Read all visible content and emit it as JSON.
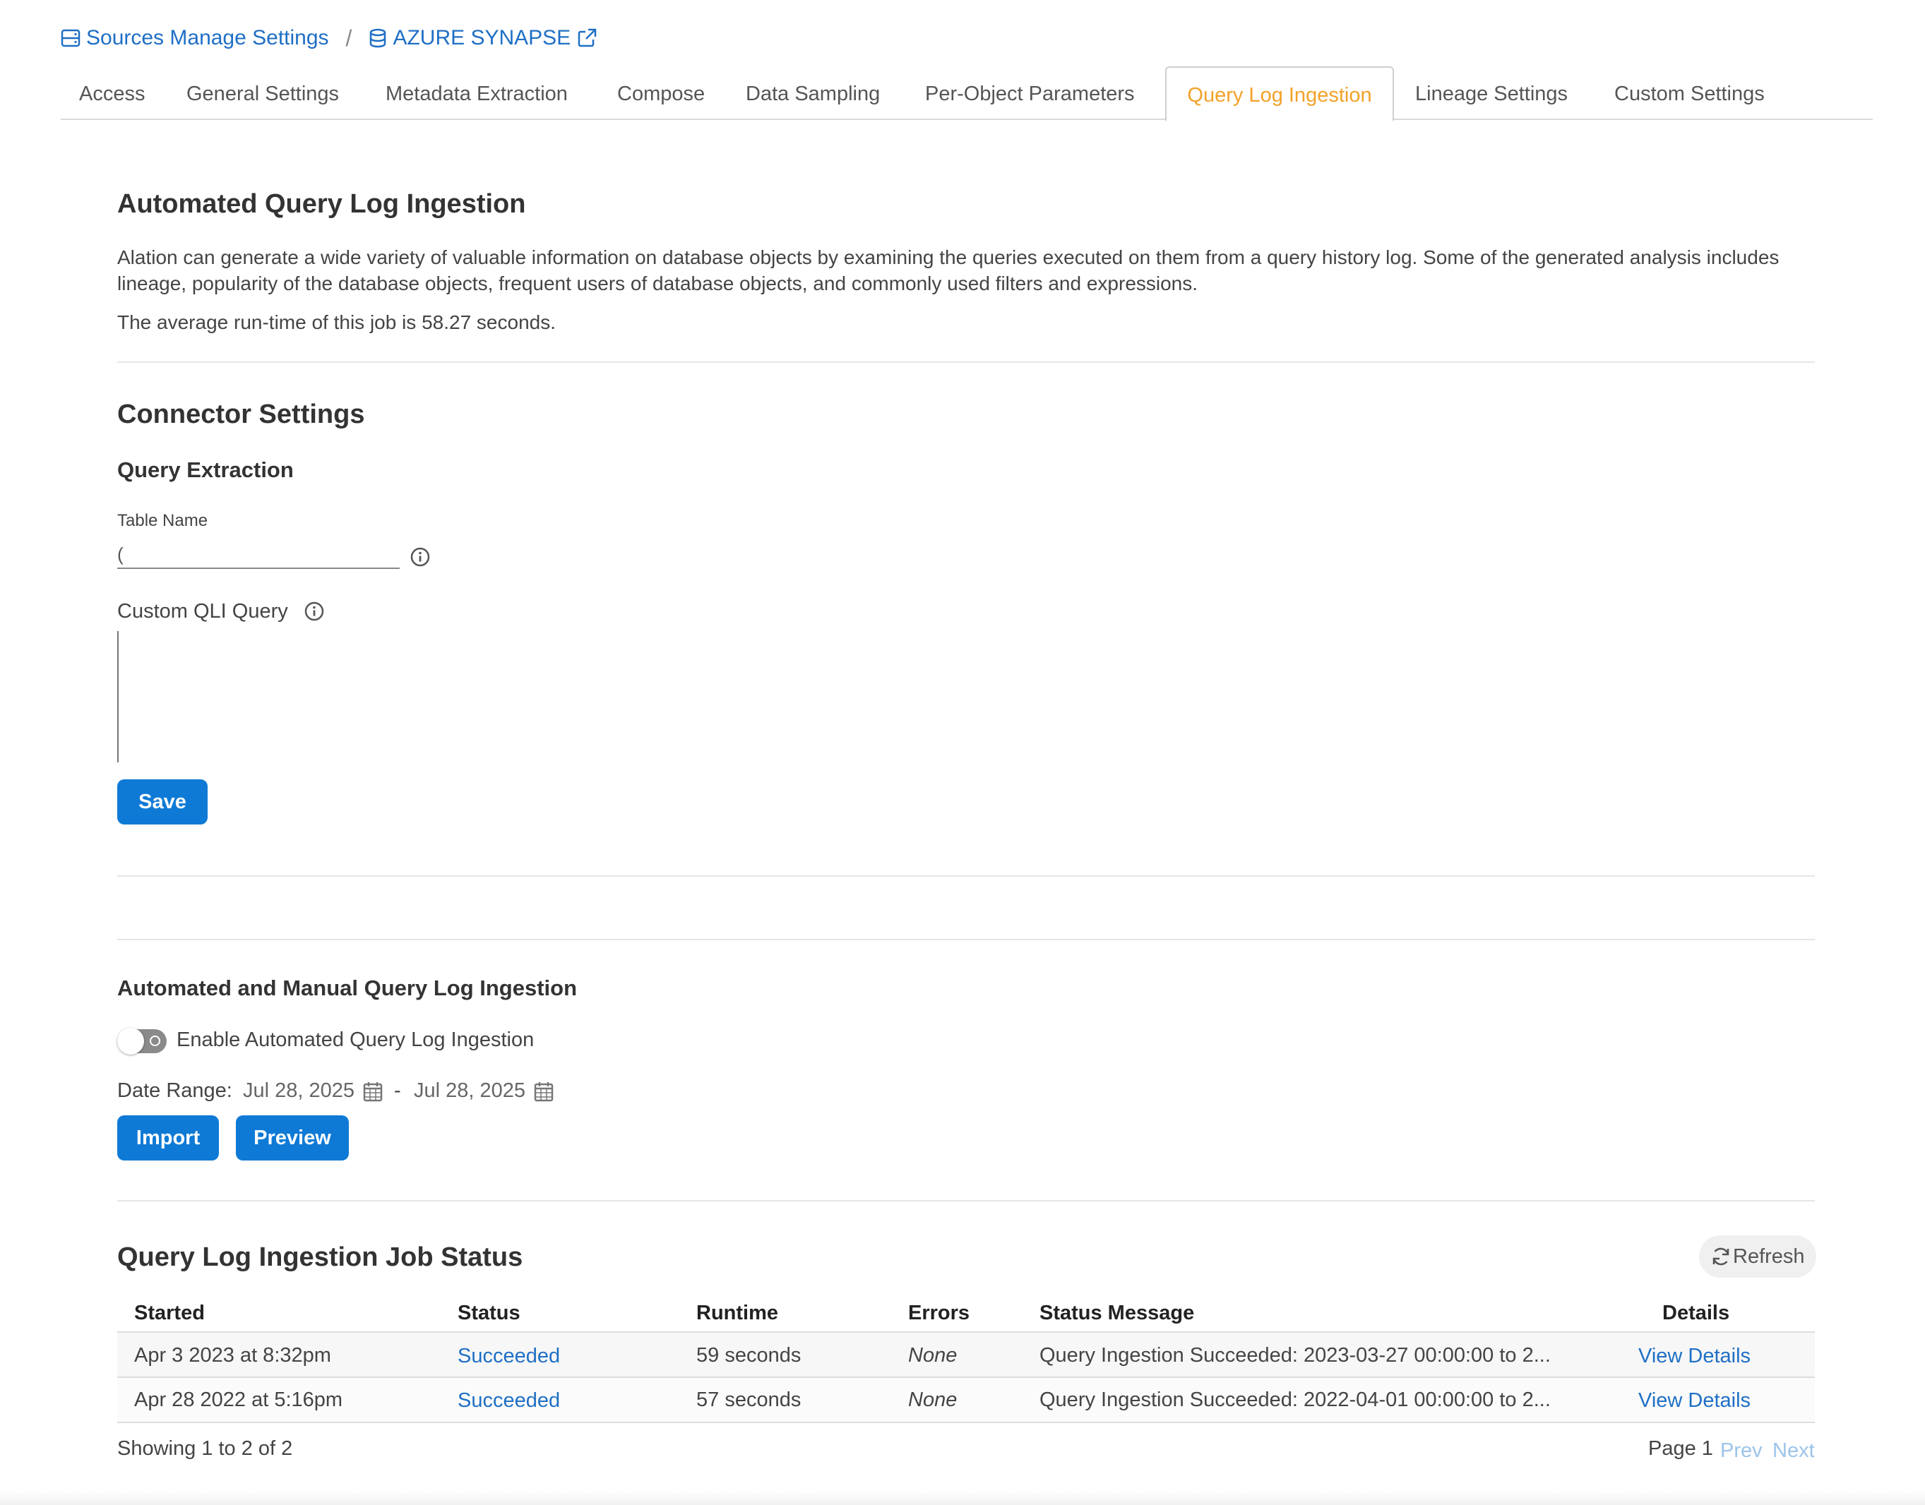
{
  "breadcrumb": {
    "source_label": "Sources Manage Settings",
    "separator": "/",
    "db_label": "AZURE SYNAPSE"
  },
  "tabs": [
    {
      "label": "Access"
    },
    {
      "label": "General Settings"
    },
    {
      "label": "Metadata Extraction"
    },
    {
      "label": "Compose"
    },
    {
      "label": "Data Sampling"
    },
    {
      "label": "Per-Object Parameters"
    },
    {
      "label": "Query Log Ingestion",
      "active": true
    },
    {
      "label": "Lineage Settings"
    },
    {
      "label": "Custom Settings"
    }
  ],
  "automated": {
    "title": "Automated Query Log Ingestion",
    "description": "Alation can generate a wide variety of valuable information on database objects by examining the queries executed on them from a query history log. Some of the generated analysis includes lineage, popularity of the database objects, frequent users of database objects, and commonly used filters and expressions.",
    "runtime_note": "The average run-time of this job is 58.27 seconds."
  },
  "connector": {
    "title": "Connector Settings",
    "subtitle": "Query Extraction",
    "table_name_label": "Table Name",
    "table_name_value": "(",
    "custom_query_label": "Custom QLI Query",
    "save_label": "Save"
  },
  "manual": {
    "title": "Automated and Manual Query Log Ingestion",
    "toggle_label": "Enable Automated Query Log Ingestion",
    "toggle_on": false,
    "date_range_label": "Date Range:",
    "date_from": "Jul 28, 2025",
    "date_sep": "-",
    "date_to": "Jul 28, 2025",
    "import_label": "Import",
    "preview_label": "Preview"
  },
  "job_status": {
    "title": "Query Log Ingestion Job Status",
    "refresh_label": "Refresh",
    "columns": [
      "Started",
      "Status",
      "Runtime",
      "Errors",
      "Status Message",
      "Details"
    ],
    "rows": [
      {
        "started": "Apr 3 2023 at 8:32pm",
        "status": "Succeeded",
        "runtime": "59 seconds",
        "errors": "None",
        "message": "Query Ingestion Succeeded: 2023-03-27 00:00:00 to 2...",
        "details": "View Details"
      },
      {
        "started": "Apr 28 2022 at 5:16pm",
        "status": "Succeeded",
        "runtime": "57 seconds",
        "errors": "None",
        "message": "Query Ingestion Succeeded: 2022-04-01 00:00:00 to 2...",
        "details": "View Details"
      }
    ],
    "showing": "Showing 1 to 2 of 2",
    "page_label": "Page 1",
    "prev_label": "Prev",
    "next_label": "Next"
  },
  "colors": {
    "link": "#1f6fc5",
    "active_tab": "#f2a22a",
    "primary_button": "#0f7ad6"
  }
}
